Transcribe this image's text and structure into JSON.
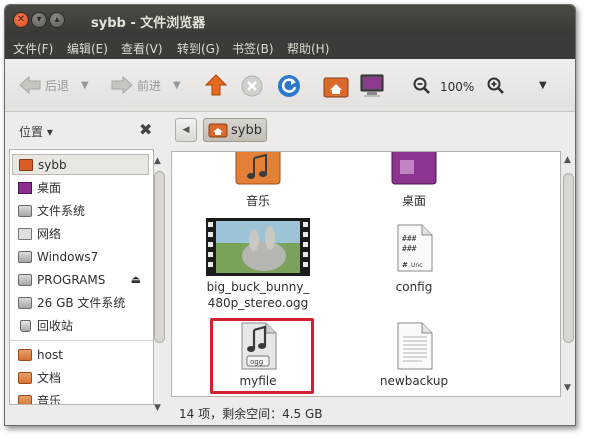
{
  "window": {
    "title": "sybb - 文件浏览器"
  },
  "menu": [
    "文件(F)",
    "编辑(E)",
    "查看(V)",
    "转到(G)",
    "书签(B)",
    "帮助(H)"
  ],
  "toolbar": {
    "back_label": "后退",
    "forward_label": "前进",
    "zoom_level": "100%"
  },
  "sidebar": {
    "title": "位置 ▾",
    "items": [
      {
        "label": "sybb",
        "icon": "home-folder-icon",
        "selected": true
      },
      {
        "label": "桌面",
        "icon": "desktop-icon"
      },
      {
        "label": "文件系统",
        "icon": "drive-icon"
      },
      {
        "label": "网络",
        "icon": "network-icon"
      },
      {
        "label": "Windows7",
        "icon": "drive-icon"
      },
      {
        "label": "PROGRAMS",
        "icon": "drive-icon"
      },
      {
        "label": "26 GB 文件系统",
        "icon": "drive-icon"
      },
      {
        "label": "回收站",
        "icon": "trash-icon"
      },
      {
        "label": "host",
        "icon": "folder-icon"
      },
      {
        "label": "文档",
        "icon": "folder-icon"
      },
      {
        "label": "音乐",
        "icon": "folder-icon"
      }
    ]
  },
  "path": {
    "current": "sybb"
  },
  "files": [
    {
      "name": "音乐",
      "icon": "music-folder-icon"
    },
    {
      "name": "桌面",
      "icon": "desktop-folder-icon"
    },
    {
      "name": "big_buck_bunny_",
      "name2": "480p_stereo.ogg",
      "icon": "video-thumbnail-icon"
    },
    {
      "name": "config",
      "icon": "script-file-icon"
    },
    {
      "name": "myfile",
      "icon": "ogg-audio-icon",
      "highlighted": true
    },
    {
      "name": "newbackup",
      "icon": "text-file-icon"
    }
  ],
  "status": {
    "text": "14 项，剩余空间：4.5 GB"
  }
}
